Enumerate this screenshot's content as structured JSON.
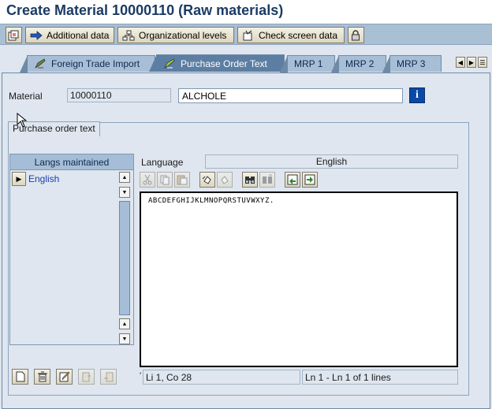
{
  "window": {
    "title": "Create Material 10000110 (Raw materials)"
  },
  "toolbar": {
    "additional_data": "Additional data",
    "org_levels": "Organizational levels",
    "check_screen_data": "Check screen data"
  },
  "tabs": [
    {
      "label": "Foreign Trade Import"
    },
    {
      "label": "Purchase Order Text"
    },
    {
      "label": "MRP 1"
    },
    {
      "label": "MRP 2"
    },
    {
      "label": "MRP 3"
    }
  ],
  "material": {
    "label": "Material",
    "number": "10000110",
    "description": "ALCHOLE"
  },
  "po_text": {
    "group_title": "Purchase order text",
    "langs_header": "Langs maintained",
    "languages": [
      "English"
    ],
    "language_label": "Language",
    "language_value": "English",
    "text_content": "ABCDEFGHIJKLMNOPQRSTUVWXYZ.",
    "status_pos_prefix": "'",
    "status_pos": "Li 1, Co 28",
    "status_lines": "Ln 1 - Ln 1 of 1 lines"
  },
  "colors": {
    "title": "#1b3b64",
    "active_tab": "#5d7ea3",
    "background": "#dfe6ef",
    "info_button": "#0a49a6"
  }
}
